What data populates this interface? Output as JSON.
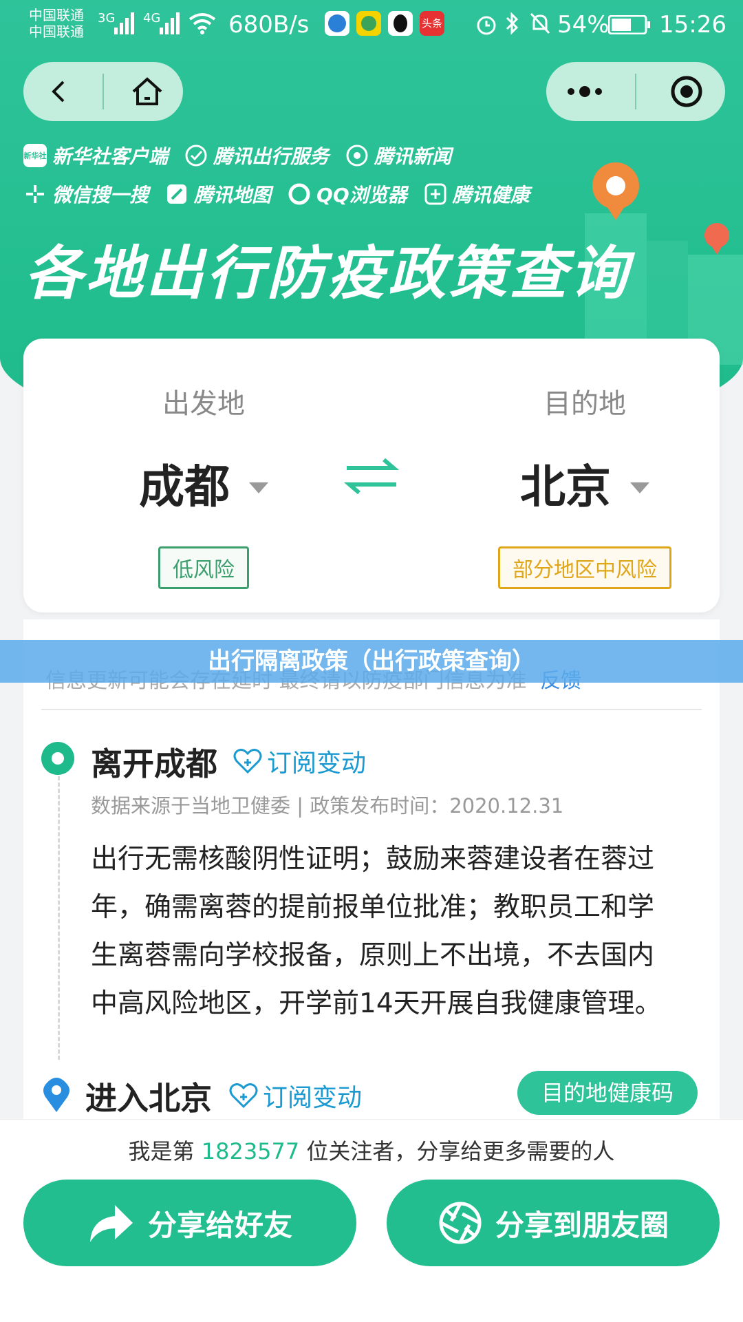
{
  "status_bar": {
    "carrier1": "中国联通",
    "carrier2": "中国联通",
    "net1": "3G",
    "net2": "4G",
    "speed": "680B/s",
    "news_badge": "头条",
    "battery": "54%",
    "time": "15:26"
  },
  "sources": {
    "row1": [
      "新华社客户端",
      "腾讯出行服务",
      "腾讯新闻"
    ],
    "row2": [
      "微信搜一搜",
      "腾讯地图",
      "QQ浏览器",
      "腾讯健康"
    ],
    "logo_text": "新华社"
  },
  "hero": {
    "title": "各地出行防疫政策查询"
  },
  "route": {
    "from_label": "出发地",
    "from_city": "成都",
    "from_risk": "低风险",
    "to_label": "目的地",
    "to_city": "北京",
    "to_risk": "部分地区中风险"
  },
  "overlay": {
    "text": "出行隔离政策（出行政策查询）"
  },
  "notice": {
    "text": "信息更新可能会存在延时 最终请以防疫部门信息为准",
    "feedback": "反馈"
  },
  "leave": {
    "title": "离开成都",
    "subscribe": "订阅变动",
    "meta": "数据来源于当地卫健委 | 政策发布时间：2020.12.31",
    "lines": [
      "出行无需核酸阴性证明；鼓励来蓉建设者在蓉过",
      "年，确需离蓉的提前报单位批准；教职员工和学",
      "生离蓉需向学校报备，原则上不出境，不去国内",
      "中高风险地区，开学前14天开展自我健康管理。"
    ]
  },
  "enter": {
    "title": "进入北京",
    "subscribe": "订阅变动",
    "health_code": "目的地健康码"
  },
  "footer": {
    "follow_prefix": "我是第",
    "follow_count": "1823577",
    "follow_suffix": "位关注者，分享给更多需要的人",
    "share_friend": "分享给好友",
    "share_moments": "分享到朋友圈"
  },
  "colors": {
    "brand_green": "#22be8f",
    "low_risk": "#3b9e6d",
    "mid_risk": "#e0a61a",
    "link_blue": "#1a9ad0"
  }
}
